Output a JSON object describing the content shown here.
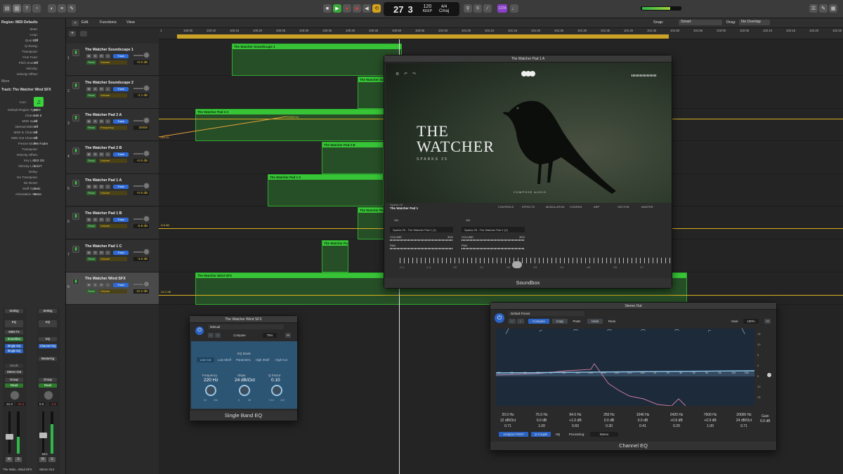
{
  "toolbar": {
    "lcd": {
      "bar": "27",
      "beat": "3",
      "tempo": "120",
      "tempo_label": "KEEP",
      "sig": "4/4",
      "key": "Cmaj"
    },
    "badge": "1234"
  },
  "inspector": {
    "region_header": "Region: MIDI Defaults",
    "region_rows": [
      {
        "k": "Mute:",
        "v": ""
      },
      {
        "k": "Loop:",
        "v": ""
      },
      {
        "k": "Quantize",
        "v": "Off"
      },
      {
        "k": "Q-Swing:",
        "v": ""
      },
      {
        "k": "Transpose:",
        "v": ""
      },
      {
        "k": "Fine Tune:",
        "v": ""
      },
      {
        "k": "Pitch Source:",
        "v": "Off"
      },
      {
        "k": "Velocity:",
        "v": ""
      },
      {
        "k": "Velocity Offset:",
        "v": ""
      }
    ],
    "more": "More",
    "track_header": "Track: The Watcher Wind SFX",
    "icon_label": "Icon:",
    "track_rows": [
      {
        "k": "Default Region Type:",
        "v": "MIDI"
      },
      {
        "k": "Channel:",
        "v": "Inst 8"
      },
      {
        "k": "MIDI Input:",
        "v": "All"
      },
      {
        "k": "Internal MIDI In:",
        "v": "Off"
      },
      {
        "k": "MIDI In Channel:",
        "v": "All"
      },
      {
        "k": "MIDI Out Channel:",
        "v": "All"
      },
      {
        "k": "Freeze Mode:",
        "v": "Pre Fader"
      },
      {
        "k": "Transpose:",
        "v": ""
      },
      {
        "k": "Velocity Offset:",
        "v": ""
      },
      {
        "k": "Key Limit:",
        "v": "C-2  G8"
      },
      {
        "k": "Velocity Limit:",
        "v": "1  127"
      },
      {
        "k": "Delay:",
        "v": ""
      },
      {
        "k": "No Transpose:",
        "v": ""
      },
      {
        "k": "No Reset:",
        "v": ""
      },
      {
        "k": "Staff Style:",
        "v": "Auto"
      },
      {
        "k": "Articulation Set:",
        "v": "None"
      }
    ]
  },
  "menus": {
    "edit": "Edit",
    "functions": "Functions",
    "view": "View",
    "snap_label": "Snap:",
    "snap_value": "Smart",
    "drag_label": "Drag:",
    "drag_value": "No Overlap"
  },
  "ruler": [
    "1",
    "100:05",
    "100:10",
    "100:15",
    "100:20",
    "100:25",
    "100:30",
    "100:35",
    "100:40",
    "100:45",
    "100:50",
    "100:55",
    "101:00",
    "101:05",
    "101:10",
    "101:15",
    "101:20",
    "101:25",
    "101:30",
    "101:35",
    "101:40",
    "101:45",
    "101:50",
    "101:55",
    "102:00",
    "102:05",
    "102:10",
    "102:15",
    "102:20",
    "102:25"
  ],
  "tracks": [
    {
      "num": "1",
      "name": "The Watcher Soundscape 1",
      "param": "Volume",
      "val": "+0.0 dB"
    },
    {
      "num": "2",
      "name": "The Watcher Soundscape 2",
      "param": "Volume",
      "val": "-2.1 dB"
    },
    {
      "num": "3",
      "name": "The Watcher Pad 2 A",
      "param": "Frequency",
      "val": "20005"
    },
    {
      "num": "4",
      "name": "The Watcher Pad 2 B",
      "param": "Volume",
      "val": "+0.0 dB"
    },
    {
      "num": "5",
      "name": "The Watcher Pad 1 A",
      "param": "Volume",
      "val": "+0.0 dB"
    },
    {
      "num": "6",
      "name": "The Watcher Pad 1 B",
      "param": "Volume",
      "val": "-5.8 dB"
    },
    {
      "num": "7",
      "name": "The Watcher Pad 1 C",
      "param": "Volume",
      "val": "-3.0 dB"
    },
    {
      "num": "8",
      "name": "The Watcher Wind SFX",
      "param": "Volume",
      "val": "-10.2 dB"
    }
  ],
  "track_controls": {
    "m": "M",
    "s": "S",
    "r": "R",
    "i": "I",
    "track": "Track",
    "read": "Read"
  },
  "regions": [
    {
      "label": "The Watcher Soundscape 1"
    },
    {
      "label": "The Watcher Sou"
    },
    {
      "label": "The Watcher Pad 2 A"
    },
    {
      "label": "The Watcher Pad 2 B"
    },
    {
      "label": "The Watcher Pad 1 A"
    },
    {
      "label": "The Watcher Pad"
    },
    {
      "label": "The Watcher Pad"
    },
    {
      "label": "The Watcher Wind SFX"
    }
  ],
  "automation_labels": {
    "a1": "148 Hz",
    "a2": "20005 Hz",
    "a3": "-5.8 dB",
    "a4": "-10.2 dB"
  },
  "soundbox": {
    "window_title": "The Watcher Pad 1 A",
    "title_line1": "THE",
    "title_line2": "WATCHER",
    "subtitle": "SPARKS 25",
    "brand": "COMPOSE AUDIO",
    "preset_small": "Sparks 25",
    "preset": "The Watcher Pad 1",
    "tabs": [
      "CONTROLS",
      "EFFECTS",
      "MODULATION",
      "CHORDS",
      "ARP",
      "VECTOR",
      "MASTER"
    ],
    "layer_a": "Sparks 25 - The Watcher Pad 1 (1)",
    "layer_b": "Sparks 25 - The Watcher Pad 1 (2)",
    "volume": "VOLUME",
    "pan": "PAN",
    "pct": "35%",
    "on": "ON",
    "keys": [
      "C-2",
      "C-1",
      "C0",
      "C1",
      "C2",
      "C3",
      "C4",
      "C5",
      "C6",
      "C7"
    ],
    "footer": "Soundbox"
  },
  "sbeq": {
    "window_title": "The Watcher Wind SFX",
    "preset": "Manual",
    "compare": "Compare",
    "pct": "75%",
    "eq_mode": "EQ Mode",
    "modes": [
      "Low Cut",
      "Low Shelf",
      "Parametric",
      "High Shelf",
      "High Cut"
    ],
    "freq_label": "Frequency",
    "freq_val": "220 Hz",
    "slope_label": "Slope",
    "slope_val": "24 dB/Oct",
    "q_label": "Q Factor",
    "q_val": "0.10",
    "freq_min": "20",
    "freq_max": "20k",
    "slope_min": "6",
    "slope_max": "48",
    "q_min": "0.10",
    "q_max": "100",
    "footer": "Single Band EQ"
  },
  "ceq": {
    "window_title": "Stereo Out",
    "preset": "Default Preset",
    "compare": "Compare",
    "copy": "Copy",
    "paste": "Paste",
    "undo": "Undo",
    "redo": "Redo",
    "view_label": "View:",
    "view_val": "100%",
    "freq_axis": [
      "20",
      "30",
      "40",
      "50",
      "60",
      "80",
      "100",
      "200",
      "300",
      "400",
      "500",
      "800",
      "1k",
      "2k",
      "3k",
      "4k",
      "6k",
      "8k",
      "10k",
      "20k"
    ],
    "db_axis": [
      "15",
      "10",
      "5",
      "0",
      "5",
      "10",
      "15"
    ],
    "bands": [
      {
        "f": "20.0 Hz",
        "g": "12 dB/Oct",
        "q": "0.71"
      },
      {
        "f": "75.0 Hz",
        "g": "0.0 dB",
        "q": "1.00"
      },
      {
        "f": "94.0 Hz",
        "g": "+1.0 dB",
        "q": "0.60"
      },
      {
        "f": "250 Hz",
        "g": "0.0 dB",
        "q": "0.30"
      },
      {
        "f": "1040 Hz",
        "g": "0.0 dB",
        "q": "0.41"
      },
      {
        "f": "2420 Hz",
        "g": "+0.6 dB",
        "q": "0.20"
      },
      {
        "f": "7600 Hz",
        "g": "+0.9 dB",
        "q": "1.00"
      },
      {
        "f": "20000 Hz",
        "g": "24 dB/Oct",
        "q": "0.71"
      }
    ],
    "gain_label": "Gain",
    "gain_val": "0.0 dB",
    "analyzer": "Analyzer POST",
    "qcouple": "Q-Couple",
    "hq": "HQ",
    "processing_label": "Processing:",
    "processing_val": "Stereo",
    "footer": "Channel EQ"
  },
  "mixer": {
    "strip1": {
      "setting": "Setting",
      "eq": "EQ",
      "midi_fx": "MIDI FX",
      "inst": "Soundbox",
      "fx1": "Single EQ",
      "fx2": "Single EQ",
      "sends": "Sends",
      "out": "Stereo Out",
      "group": "Group",
      "read": "Read",
      "vol": "-10.2",
      "peak": "-23.4",
      "name": "The Wato...Wind SFX"
    },
    "strip2": {
      "setting": "Setting",
      "eq": "EQ",
      "fx1": "Channel EQ",
      "bounce": "Mastering",
      "group": "Group",
      "read": "Read",
      "vol": "0.0",
      "peak": "-2.6",
      "bnc": "Bnc",
      "name": "Stereo Out"
    },
    "m": "M",
    "s": "S"
  }
}
